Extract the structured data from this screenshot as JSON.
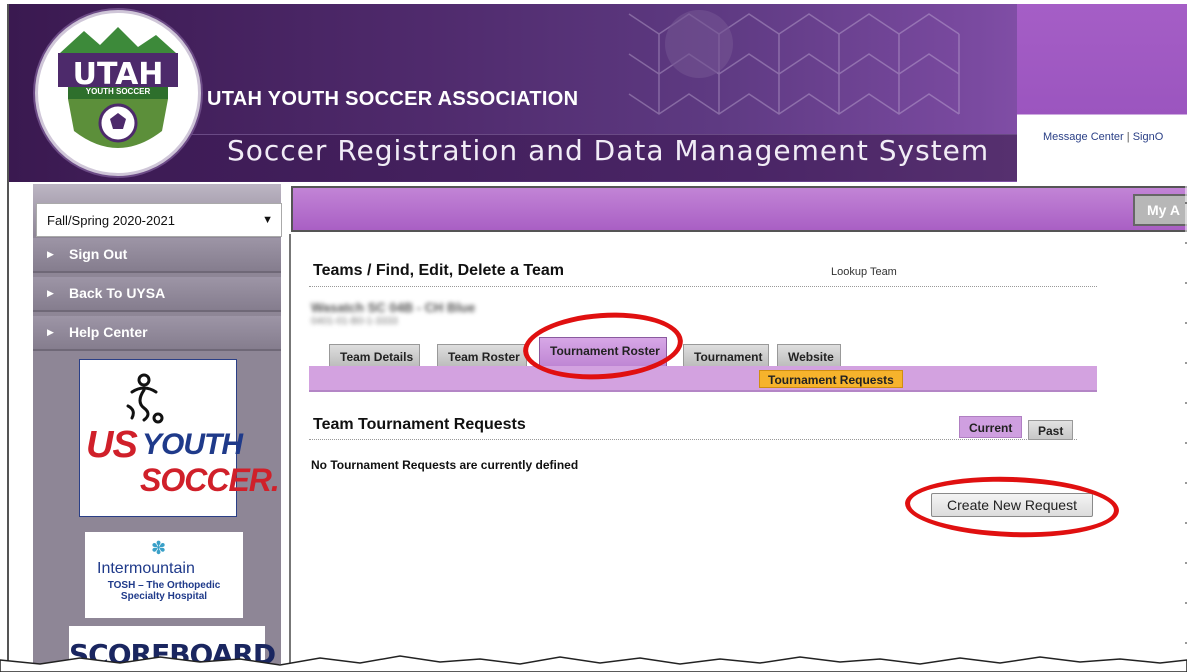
{
  "banner": {
    "logo_text": "UTAH",
    "logo_subtext": "YOUTH SOCCER",
    "org_name": "UTAH YOUTH SOCCER ASSOCIATION",
    "system_name": "Soccer Registration and Data Management System",
    "top_links": [
      "Message Center",
      "SignO"
    ]
  },
  "sidebar": {
    "season": "Fall/Spring 2020-2021",
    "items": [
      {
        "label": "Sign Out"
      },
      {
        "label": "Back To UYSA"
      },
      {
        "label": "Help Center"
      }
    ],
    "sponsors": {
      "usys": {
        "us": "US",
        "youth": "YOUTH",
        "soccer": "SOCCER."
      },
      "intermountain": {
        "name": "Intermountain",
        "sub": "TOSH – The Orthopedic Specialty Hospital"
      },
      "scoreboard": "SCOREBOARD"
    }
  },
  "header": {
    "my_account": "My A"
  },
  "main": {
    "title": "Teams / Find, Edit, Delete a Team",
    "lookup_link": "Lookup Team",
    "team_name_blurred": "Wasatch SC 04B - CH Blue",
    "team_id_blurred": "0401-01-B0-1-3333",
    "tabs": [
      {
        "label": "Team Details",
        "active": false
      },
      {
        "label": "Team Roster",
        "active": false
      },
      {
        "label": "Tournament Roster",
        "active": true
      },
      {
        "label": "Tournament",
        "active": false
      },
      {
        "label": "Website",
        "active": false
      }
    ],
    "subtab": "Tournament Requests",
    "section_title": "Team Tournament Requests",
    "filter_tabs": [
      {
        "label": "Current",
        "active": true
      },
      {
        "label": "Past",
        "active": false
      }
    ],
    "empty_message": "No Tournament Requests are currently defined",
    "create_button": "Create New Request"
  },
  "colors": {
    "banner_purple": "#4f2a6c",
    "accent_purple": "#a95fc4",
    "subtab_orange": "#f6b32c",
    "annotation_red": "#e01010"
  }
}
